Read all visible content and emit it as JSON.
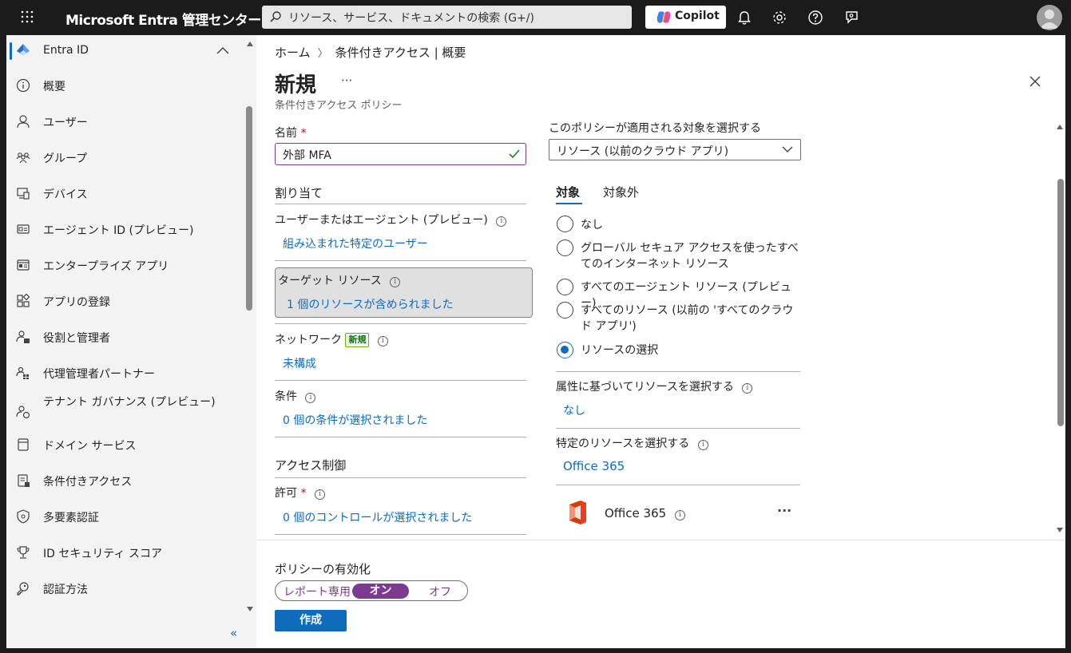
{
  "topbar": {
    "brand": "Microsoft Entra 管理センター",
    "search_placeholder": "リソース、サービス、ドキュメントの検索 (G+/)",
    "copilot_label": "Copilot"
  },
  "sidebar": {
    "header": "Entra ID",
    "items": [
      {
        "label": "概要",
        "icon": "info-icon"
      },
      {
        "label": "ユーザー",
        "icon": "user-icon"
      },
      {
        "label": "グループ",
        "icon": "group-icon"
      },
      {
        "label": "デバイス",
        "icon": "devices-icon"
      },
      {
        "label": "エージェント ID (プレビュー)",
        "icon": "agent-id-icon"
      },
      {
        "label": "エンタープライズ アプリ",
        "icon": "enterprise-app-icon"
      },
      {
        "label": "アプリの登録",
        "icon": "app-registration-icon"
      },
      {
        "label": "役割と管理者",
        "icon": "roles-icon"
      },
      {
        "label": "代理管理者パートナー",
        "icon": "partner-icon"
      },
      {
        "label": "テナント ガバナンス (プレビュー)",
        "icon": "tenant-governance-icon"
      },
      {
        "label": "ドメイン サービス",
        "icon": "domain-services-icon"
      },
      {
        "label": "条件付きアクセス",
        "icon": "conditional-access-icon"
      },
      {
        "label": "多要素認証",
        "icon": "mfa-shield-icon"
      },
      {
        "label": "ID セキュリティ スコア",
        "icon": "trophy-icon"
      },
      {
        "label": "認証方法",
        "icon": "auth-methods-icon"
      }
    ],
    "collapse_glyph": "«"
  },
  "main": {
    "breadcrumb": [
      "ホーム",
      "条件付きアクセス | 概要"
    ],
    "title": "新規",
    "more": "···",
    "subtitle": "条件付きアクセス ポリシー",
    "name_label": "名前",
    "required_mark": "*",
    "name_value": "外部 MFA",
    "assign_heading": "割り当て",
    "users_label": "ユーザーまたはエージェント (プレビュー)",
    "users_link": "組み込まれた特定のユーザー",
    "target_label": "ターゲット リソース",
    "target_link": "1 個のリソースが含められました",
    "network_label": "ネットワーク",
    "network_badge": "新規",
    "network_link": "未構成",
    "conditions_label": "条件",
    "conditions_link": "0 個の条件が選択されました",
    "access_heading": "アクセス制御",
    "grant_label": "許可",
    "grant_link": "0 個のコントロールが選択されました",
    "apply_label": "このポリシーが適用される対象を選択する",
    "apply_value": "リソース (以前のクラウド アプリ)",
    "tabs": [
      "対象",
      "対象外"
    ],
    "radios": [
      {
        "label": "なし",
        "selected": false
      },
      {
        "label": "グローバル セキュア アクセスを使ったすべてのインターネット リソース",
        "selected": false
      },
      {
        "label": "すべてのエージェント リソース (プレビュー)",
        "selected": false
      },
      {
        "label": "すべてのリソース (以前の 'すべてのクラウド アプリ')",
        "selected": false
      },
      {
        "label": "リソースの選択",
        "selected": true
      }
    ],
    "attr_label": "属性に基づいてリソースを選択する",
    "attr_link": "なし",
    "specific_label": "特定のリソースを選択する",
    "specific_link": "Office 365",
    "resource_item": "Office 365",
    "resource_more": "···"
  },
  "footer": {
    "enable_label": "ポリシーの有効化",
    "toggle": [
      "レポート専用",
      "オン",
      "オフ"
    ],
    "toggle_selected": "オン",
    "create_label": "作成"
  },
  "colors": {
    "accent": "#0f6cbd",
    "toggle_purple": "#7c3a91",
    "topbar": "#1b1b1b"
  }
}
